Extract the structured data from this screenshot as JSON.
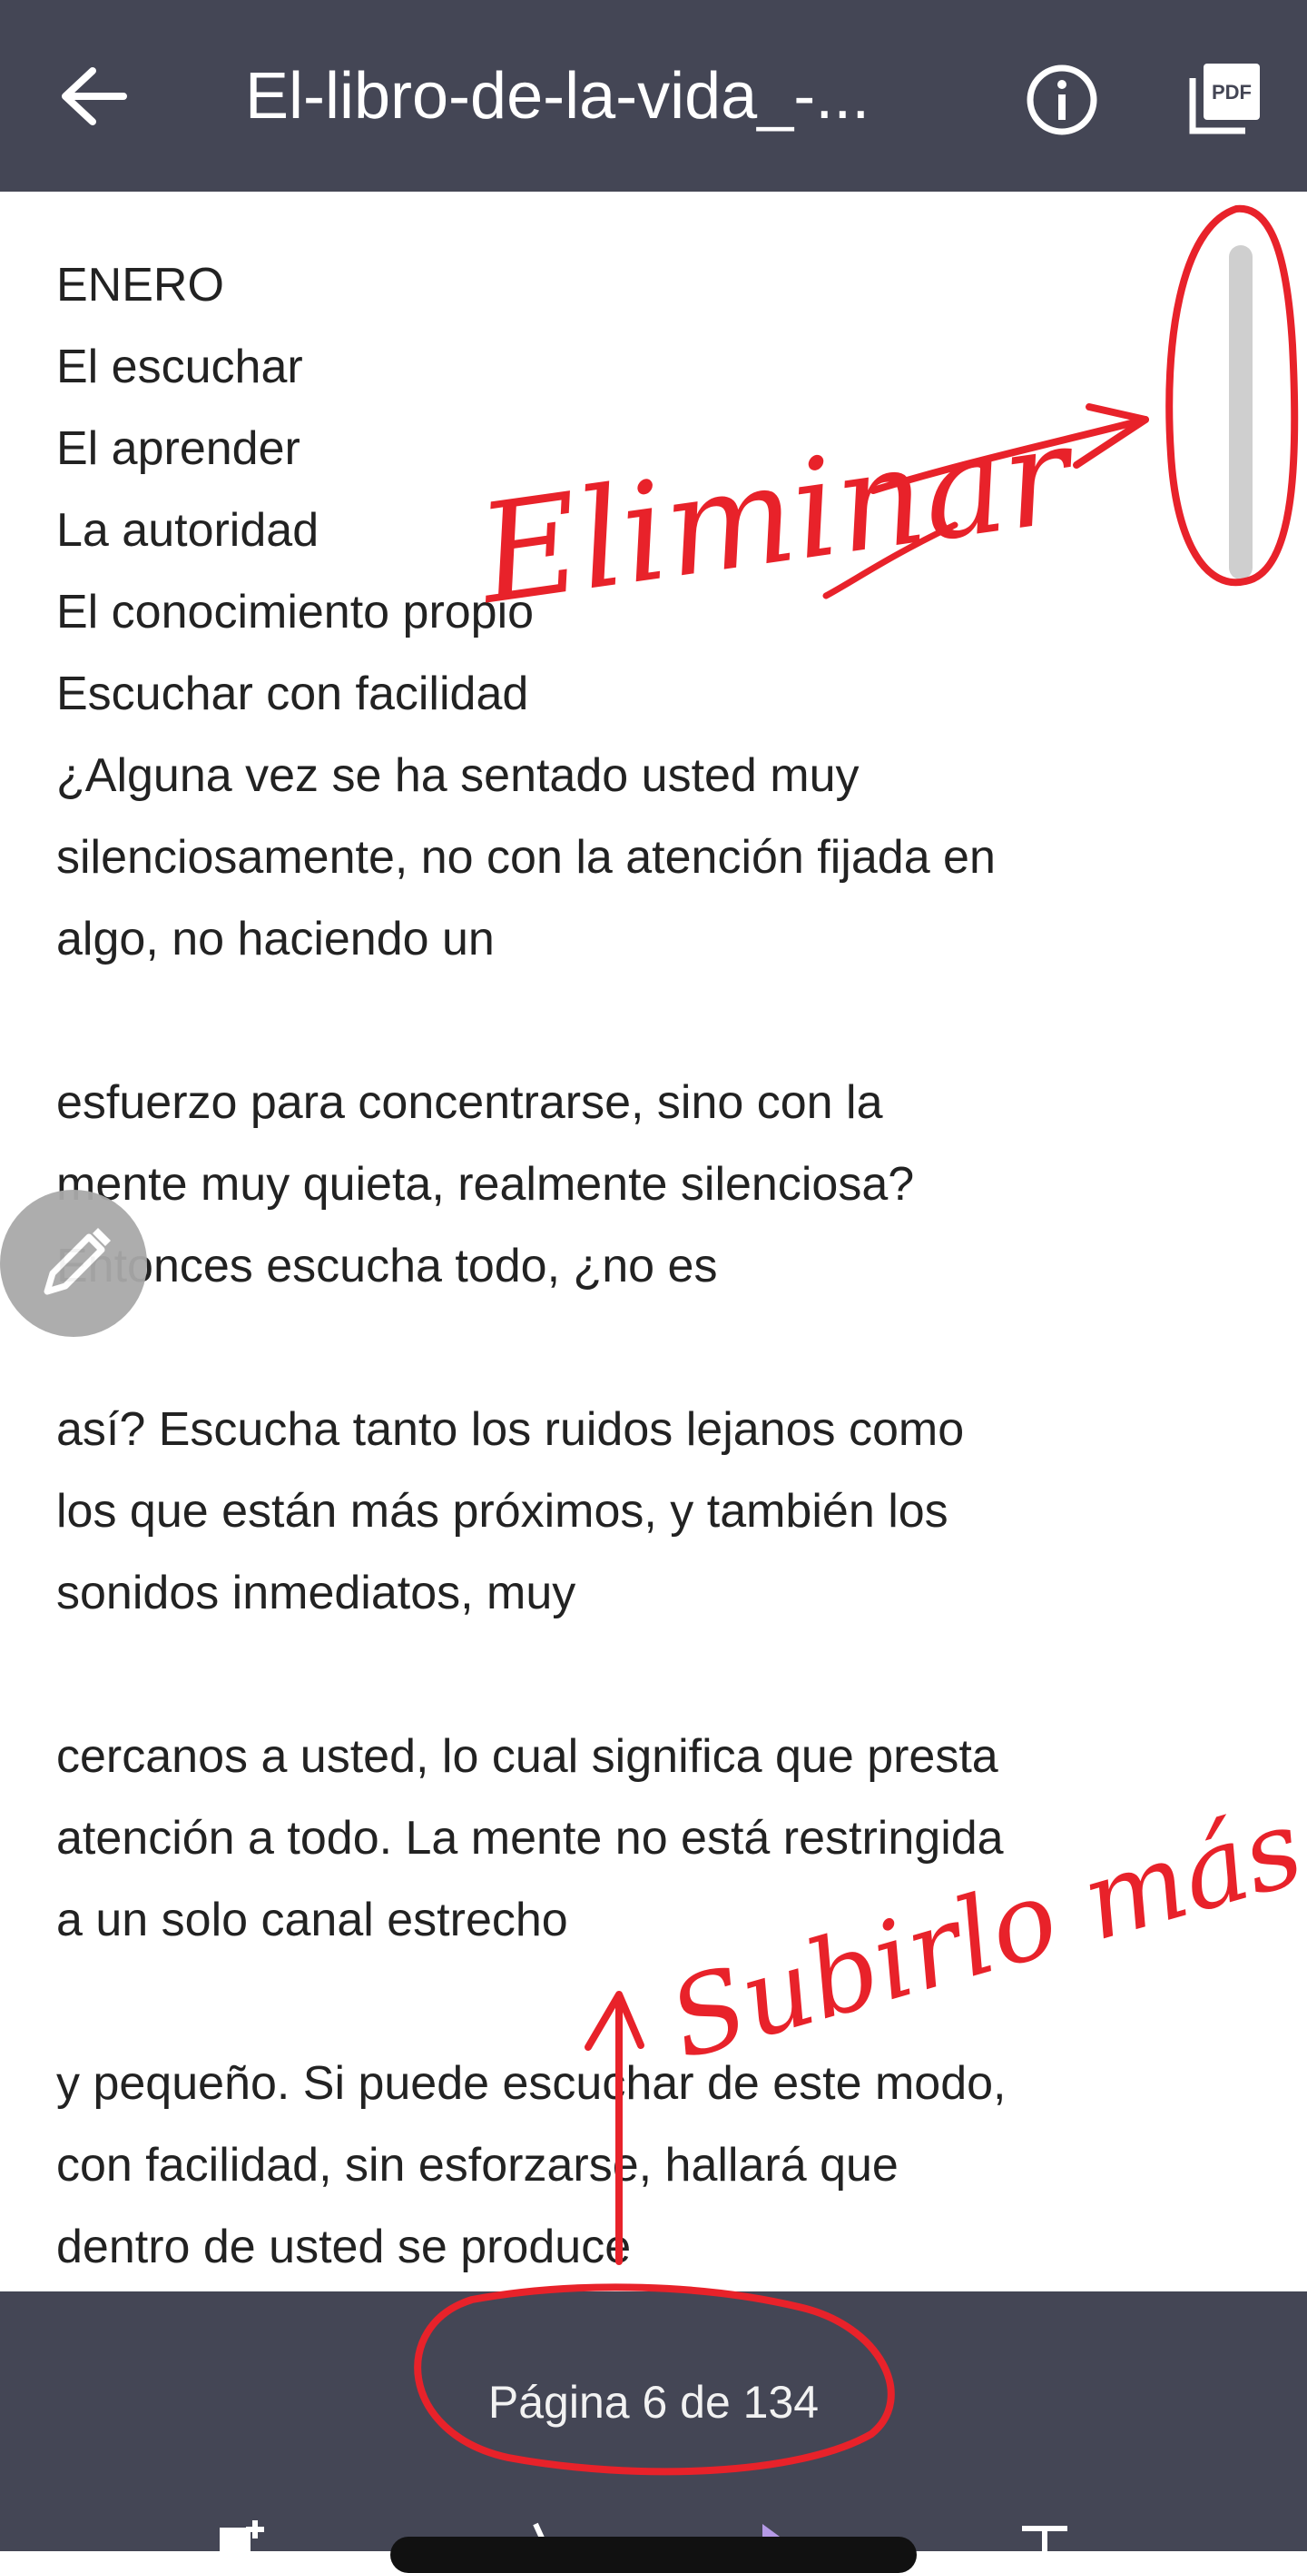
{
  "header": {
    "title": "El-libro-de-la-vida_-...",
    "back_icon": "arrow-left-icon",
    "info_icon": "info-icon",
    "pdf_icon": "pdf-icon",
    "pdf_label": "PDF"
  },
  "document": {
    "lines": [
      "ENERO",
      "El escuchar",
      "El aprender",
      "La autoridad",
      "El conocimiento propio",
      "Escuchar con facilidad",
      "¿Alguna vez se ha sentado usted muy",
      "silenciosamente, no con la atención fijada en",
      "algo, no haciendo un",
      "esfuerzo para concentrarse, sino con la",
      "mente muy quieta, realmente silenciosa?",
      "Entonces escucha todo, ¿no es",
      "así? Escucha tanto los ruidos lejanos como",
      "los que están más próximos, y también los",
      "sonidos inmediatos, muy",
      "cercanos a usted, lo cual significa que presta",
      "atención a todo. La mente no está restringida",
      "a un solo canal estrecho",
      "y pequeño. Si puede escuchar de este modo,",
      "con facilidad, sin esforzarse, hallará que",
      "dentro de usted se produce"
    ]
  },
  "footer": {
    "page_indicator": "Página 6 de 134"
  },
  "annotations": {
    "note_1": "Eliminar",
    "note_2": "Subirlo más arriba",
    "color": "#e8222a"
  },
  "colors": {
    "bar_background": "#444655",
    "text": "#222222",
    "scrollbar": "#cfcfcf"
  }
}
